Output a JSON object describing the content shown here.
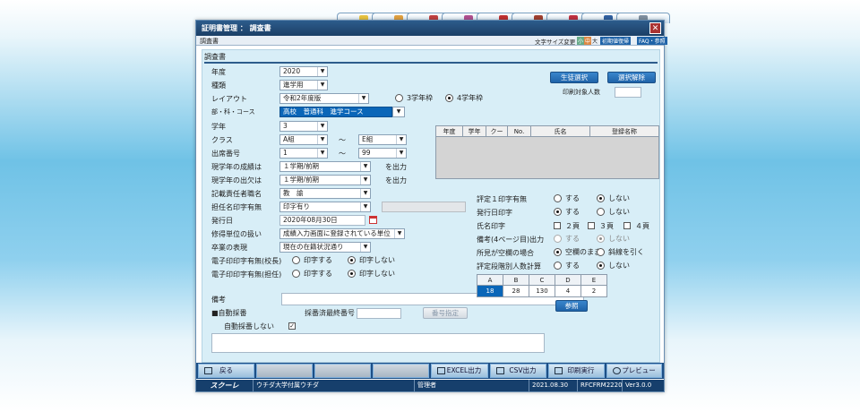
{
  "window": {
    "title": "証明書管理 ： 調査書",
    "close": "✕"
  },
  "subbar": {
    "screen_name": "調査書",
    "font_size_label": "文字サイズ変更",
    "font_small": "小",
    "font_medium": "中",
    "font_large": "大",
    "btn_init": "初期値復帰",
    "btn_faq": "FAQ・参照"
  },
  "form": {
    "section_title": "調査書",
    "labels": {
      "nendo": "年度",
      "shurui": "種類",
      "layout": "レイアウト",
      "course": "部・科・コース",
      "gakunen": "学年",
      "class": "クラス",
      "shusseki": "出席番号",
      "seiseki": "現学年の成績は",
      "shukketsu": "現学年の出欠は",
      "kisai": "記載責任者職名",
      "tannin": "担任名印字有無",
      "hakko": "発行日",
      "shuutoku": "修得単位の扱い",
      "sotsugyo": "卒業の表現",
      "denshi_kocho": "電子印印字有無(校長)",
      "denshi_tannin": "電子印印字有無(担任)",
      "biko": "備考",
      "jido": "■自動採番",
      "saiban_saishu": "採番済最終番号",
      "jido_shinai": "自動採番しない"
    },
    "values": {
      "nendo": "2020",
      "shurui": "進学用",
      "layout": "令和2年度版",
      "course": "高校　普通科　進学コース",
      "gakunen": "3",
      "class_from": "A組",
      "class_to": "E組",
      "shusseki_from": "1",
      "shusseki_to": "99",
      "seiseki": "１学期/前期",
      "shukketsu": "１学期/前期",
      "kisai": "教　諭",
      "tannin": "印字有り",
      "hakko": "2020年08月30日",
      "shuutoku": "成績入力画面に登録されている単位",
      "sotsugyo": "現在の在籍状況通り"
    },
    "tilde1": "～",
    "tilde2": "～",
    "wo_shutsuryoku1": "を出力",
    "wo_shutsuryoku2": "を出力",
    "radio_3gakunen": "3学年枠",
    "radio_4gakunen": "4学年枠",
    "suru": "印字する",
    "shinai": "印字しない",
    "btn_seito": "生徒選択",
    "btn_kaijo": "選択解除",
    "insatsu_taisho": "印刷対象人数",
    "bango_shitei": "番号指定"
  },
  "student_grid": {
    "headers": [
      "年度",
      "学年",
      "クー",
      "No.",
      "氏名",
      "登録名称"
    ]
  },
  "right": {
    "hyotei_label": "評定１印字有無",
    "hakkosha_label": "発行日印字",
    "shimei_label": "氏名印字",
    "biko4_label": "備考(4ページ目)出力",
    "shoken_label": "所見が空欄の場合",
    "hyotei_dankai_label": "評定段階別人数計算",
    "suru": "する",
    "shinai": "しない",
    "p2": "２頁",
    "p3": "３頁",
    "p4": "４頁",
    "kuuran": "空欄のまま",
    "shasen": "斜線を引く",
    "grade_headers": [
      "A",
      "B",
      "C",
      "D",
      "E"
    ],
    "grade_values": [
      "18",
      "28",
      "130",
      "4",
      "2"
    ],
    "btn_sansho": "参照"
  },
  "bottom": {
    "back": "戻る",
    "excel": "EXCEL出力",
    "csv": "CSV出力",
    "print": "印刷実行",
    "preview": "プレビュー"
  },
  "status": {
    "logo": "スクーレ",
    "school": "ウチダ大学付属ウチダ",
    "user": "管理者",
    "date": "2021.08.30",
    "form_id": "RFCFRM2220",
    "version": "Ver3.0.0"
  },
  "colors": {
    "accent": "#1f63a8",
    "title_bar": "#1b3f66",
    "highlight": "#0a66b8"
  }
}
